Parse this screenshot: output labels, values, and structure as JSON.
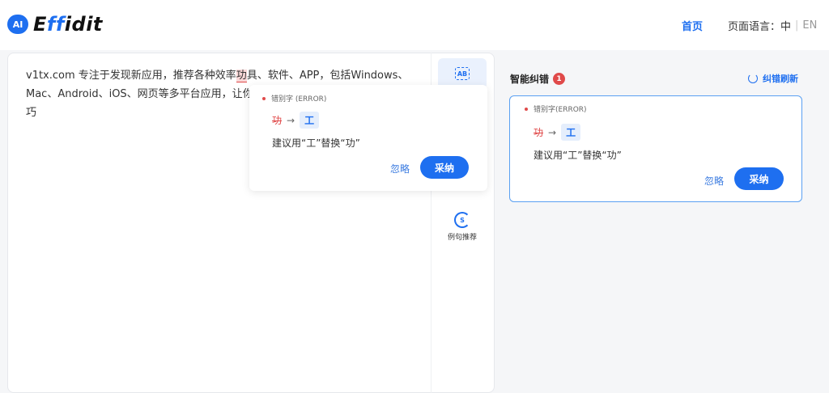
{
  "header": {
    "logo_badge": "AI",
    "logo_text_pre": "E",
    "logo_text_hl": "ff",
    "logo_text_post": "idit",
    "nav_home": "首页",
    "lang_label": "页面语言：中",
    "lang_sep": "|",
    "lang_en": "EN"
  },
  "editor": {
    "text_before": "v1tx.com 专注于发现新应用，推荐各种效率",
    "error_word": "功",
    "text_after": "具、软件、APP，包括Windows、Mac、Android、iOS、网页等多平台应用，让",
    "text_hidden_tail": "你",
    "text_line3": "巧"
  },
  "tools": {
    "ab_icon_label": "AB",
    "example_icon_label": "S",
    "example_label": "例句推荐"
  },
  "popup": {
    "type": "错别字 (ERROR)",
    "wrong": "功",
    "arrow": "→",
    "right": "工",
    "suggestion": "建议用“工”替换“功”",
    "ignore": "忽略",
    "adopt": "采纳"
  },
  "panel": {
    "title": "智能纠错",
    "count": "1",
    "refresh": "纠错刷新",
    "card": {
      "type": "错别字(ERROR)",
      "wrong": "功",
      "arrow": "→",
      "right": "工",
      "suggestion": "建议用“工”替换“功”",
      "ignore": "忽略",
      "adopt": "采纳"
    }
  },
  "colors": {
    "accent": "#1e6ff0",
    "error": "#e04a4a",
    "background": "#f5f6f8"
  }
}
